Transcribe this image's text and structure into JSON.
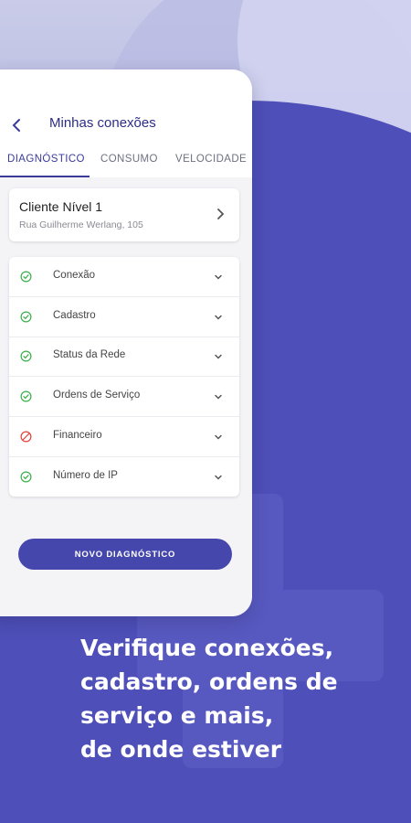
{
  "header": {
    "title": "Minhas conexões"
  },
  "tabs": [
    {
      "label": "DIAGNÓSTICO",
      "active": true
    },
    {
      "label": "CONSUMO",
      "active": false
    },
    {
      "label": "VELOCIDADE",
      "active": false
    }
  ],
  "client_card": {
    "title": "Cliente Nível 1",
    "address": "Rua Guilherme Werlang, 105"
  },
  "diagnostics": [
    {
      "label": "Conexão",
      "status": "ok",
      "icon": "check-circle-icon"
    },
    {
      "label": "Cadastro",
      "status": "ok",
      "icon": "check-circle-icon"
    },
    {
      "label": "Status da Rede",
      "status": "ok",
      "icon": "check-circle-icon"
    },
    {
      "label": "Ordens de Serviço",
      "status": "ok",
      "icon": "check-circle-icon"
    },
    {
      "label": "Financeiro",
      "status": "error",
      "icon": "blocked-circle-icon"
    },
    {
      "label": "Número de IP",
      "status": "ok",
      "icon": "check-circle-icon"
    }
  ],
  "button": {
    "label": "NOVO DIAGNÓSTICO"
  },
  "headline": {
    "line1": "Verifique conexões,",
    "line2": "cadastro, ordens de",
    "line3": "serviço e mais,",
    "line4": "de onde estiver"
  },
  "colors": {
    "primary": "#4647ac",
    "ok": "#3cae4a",
    "error": "#e2423a",
    "background": "#4e4fb8"
  }
}
